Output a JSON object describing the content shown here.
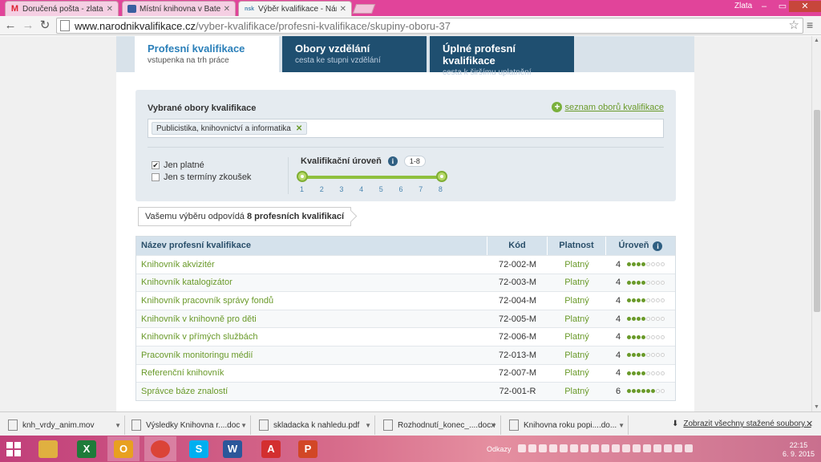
{
  "browser": {
    "tabs": [
      {
        "title": "Doručená pošta - zlata.ho",
        "icon": "gmail-icon"
      },
      {
        "title": "Místní knihovna v Batelov",
        "icon": "library-icon"
      },
      {
        "title": "Výběr kvalifikace - Národ",
        "icon": "nsk-icon",
        "favicon_text": "nsk"
      }
    ],
    "user": "Zlata",
    "url_domain": "www.narodnikvalifikace.cz",
    "url_path": "/vyber-kvalifikace/profesni-kvalifikace/skupiny-oboru-37"
  },
  "qual_tabs": [
    {
      "title": "Profesní kvalifikace",
      "subtitle": "vstupenka na trh práce"
    },
    {
      "title": "Obory vzdělání",
      "subtitle": "cesta ke stupni vzdělání"
    },
    {
      "title": "Úplné profesní kvalifikace",
      "subtitle": "cesta k širšímu uplatnění"
    }
  ],
  "filter": {
    "title": "Vybrané obory kvalifikace",
    "list_link": "seznam oborů kvalifikace",
    "tag": "Publicistika, knihovnictví a informatika",
    "checkbox_valid": "Jen platné",
    "checkbox_valid_checked": true,
    "checkbox_exam": "Jen s termíny zkoušek",
    "checkbox_exam_checked": false,
    "level_label": "Kvalifikační úroveň",
    "level_range": "1-8",
    "level_ticks": [
      "1",
      "2",
      "3",
      "4",
      "5",
      "6",
      "7",
      "8"
    ],
    "level_min": 1,
    "level_max": 8
  },
  "result": {
    "prefix": "Vašemu výběru odpovídá",
    "count_text": "8 profesních kvalifikací"
  },
  "table": {
    "headers": [
      "Název profesní kvalifikace",
      "Kód",
      "Platnost",
      "Úroveň"
    ],
    "rows": [
      {
        "name": "Knihovník akvizitér",
        "code": "72-002-M",
        "validity": "Platný",
        "level": "4",
        "dots": 4
      },
      {
        "name": "Knihovník katalogizátor",
        "code": "72-003-M",
        "validity": "Platný",
        "level": "4",
        "dots": 4
      },
      {
        "name": "Knihovník pracovník správy fondů",
        "code": "72-004-M",
        "validity": "Platný",
        "level": "4",
        "dots": 4
      },
      {
        "name": "Knihovník v knihovně pro děti",
        "code": "72-005-M",
        "validity": "Platný",
        "level": "4",
        "dots": 4
      },
      {
        "name": "Knihovník v přímých službách",
        "code": "72-006-M",
        "validity": "Platný",
        "level": "4",
        "dots": 4
      },
      {
        "name": "Pracovník monitoringu médií",
        "code": "72-013-M",
        "validity": "Platný",
        "level": "4",
        "dots": 4
      },
      {
        "name": "Referenční knihovník",
        "code": "72-007-M",
        "validity": "Platný",
        "level": "4",
        "dots": 4
      },
      {
        "name": "Správce báze znalostí",
        "code": "72-001-R",
        "validity": "Platný",
        "level": "6",
        "dots": 6
      }
    ]
  },
  "downloads": {
    "items": [
      "knh_vrdy_anim.mov",
      "Výsledky Knihovna r....doc",
      "skladacka k nahledu.pdf",
      "Rozhodnutí_konec_....docx",
      "Knihovna roku popi....do..."
    ],
    "show_all": "Zobrazit všechny stažené soubory..."
  },
  "taskbar": {
    "apps": [
      {
        "icon": "file-explorer-icon",
        "color": "#e0b040"
      },
      {
        "icon": "excel-icon",
        "color": "#1e7b3a",
        "glyph": "X"
      },
      {
        "icon": "outlook-icon",
        "color": "#e8a020",
        "glyph": "O"
      },
      {
        "icon": "chrome-icon",
        "color": "#db4437"
      },
      {
        "icon": "skype-icon",
        "color": "#00aff0",
        "glyph": "S"
      },
      {
        "icon": "word-icon",
        "color": "#2b579a",
        "glyph": "W"
      },
      {
        "icon": "acrobat-icon",
        "color": "#d32f2f",
        "glyph": "A"
      },
      {
        "icon": "powerpoint-icon",
        "color": "#d24726",
        "glyph": "P"
      }
    ],
    "links_label": "Odkazy",
    "time": "22:15",
    "date": "6. 9. 2015"
  },
  "colors": {
    "accent": "#2a7fb9",
    "link": "#6a9a2a",
    "dark_tab": "#1f4f70",
    "taskbar": "#c13f7a"
  }
}
